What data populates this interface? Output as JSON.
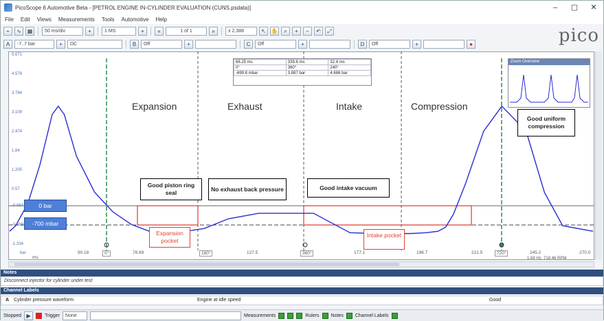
{
  "window": {
    "title": "PicoScope 6 Automotive Beta - [PETROL ENGINE IN-CYLINDER EVALUATION (CUNS.psdata)]",
    "min": "–",
    "max": "▢",
    "close": "✕"
  },
  "menu": [
    "File",
    "Edit",
    "Views",
    "Measurements",
    "Tools",
    "Automotive",
    "Help"
  ],
  "toolbar1": {
    "timebase": "50 ms/div",
    "samples": "1 MS",
    "page": "1 of 1",
    "zoom": "x 2,388"
  },
  "toolbar2": {
    "ch_a_range": "-7..7 bar",
    "coupling": "DC",
    "ch_b": "Off",
    "ch_c": "Off",
    "ch_d": "Off"
  },
  "logo": "pico",
  "y_ticks": [
    "5.671",
    "4.578",
    "3.784",
    "3.109",
    "2.474",
    "1.84",
    "1.205",
    "0.57",
    "-0.064",
    "-0.699",
    "-1.334"
  ],
  "y_unit": "bar",
  "x_ticks": [
    "90.18",
    "78.89",
    "127.5",
    "177.1",
    "196.7",
    "221.5",
    "245.2",
    "270.0"
  ],
  "x_unit": "ms",
  "cursor_labels": [
    "0°",
    "180°",
    "360°",
    "540°",
    "720°"
  ],
  "phases": [
    "Expansion",
    "Exhaust",
    "Intake",
    "Compression"
  ],
  "callouts": {
    "piston": "Good piston ring seal",
    "exhaust": "No exhaust back pressure",
    "intake": "Good intake vacuum",
    "compression": "Good uniform compression"
  },
  "markers": {
    "zero_bar": "0 bar",
    "minus700": "-700 mbar"
  },
  "pockets": {
    "expansion": "Expansion pocket",
    "intake": "Intake pocket"
  },
  "measurements": {
    "rows": [
      [
        "66.25 ms",
        "339.8 ms",
        "32.4 ms"
      ],
      [
        "0°",
        "360°",
        "240°"
      ],
      [
        "-699.8 mbar",
        "3.887 bar",
        "4.686 bar"
      ]
    ]
  },
  "zoom_overview_title": "Zoom Overview",
  "bottom_right_readout": "1.69 Hz, 718.46 RPM",
  "notes": {
    "header": "Notes",
    "text": "Disconnect injector for cylinder under test"
  },
  "channel_labels": {
    "header": "Channel Labels",
    "channel": "A",
    "label": "Cylinder pressure waveform",
    "description": "Engine at idle speed",
    "status": "Good"
  },
  "statusbar": {
    "stopped": "Stopped",
    "trigger": "Trigger",
    "trigger_mode": "None",
    "measurements": "Measurements",
    "rulers": "Rulers",
    "notes": "Notes",
    "channel_labels": "Channel Labels"
  },
  "chart_data": {
    "type": "line",
    "series": [
      {
        "name": "A",
        "color": "#2a2ad4",
        "x": [
          78,
          80,
          84,
          88,
          92,
          94,
          96,
          100,
          106,
          112,
          118,
          124,
          130,
          136,
          142,
          150,
          160,
          170,
          178,
          190,
          200,
          210,
          215,
          219,
          221.5,
          224,
          228,
          234,
          240,
          248,
          254,
          260,
          270
        ],
        "y": [
          -0.6,
          -0.4,
          0.4,
          1.8,
          3.6,
          3.9,
          3.6,
          2.1,
          0.8,
          0.1,
          -0.35,
          -0.6,
          -0.64,
          -0.6,
          -0.5,
          -0.15,
          0.05,
          0.05,
          0.05,
          -0.65,
          -0.68,
          -0.68,
          -0.65,
          -0.6,
          -0.45,
          0.0,
          1.1,
          3.0,
          3.9,
          3.0,
          0.8,
          -0.4,
          -0.6
        ]
      }
    ],
    "ylim": [
      -1.334,
      5.671
    ],
    "xlim": [
      78,
      270
    ]
  },
  "colors": {
    "trace": "#2a2ad4",
    "cursor": "#2e8b57",
    "pocket": "#d43b2b",
    "marker_box": "#4f7fd6",
    "panel_header": "#2f4f7f"
  }
}
